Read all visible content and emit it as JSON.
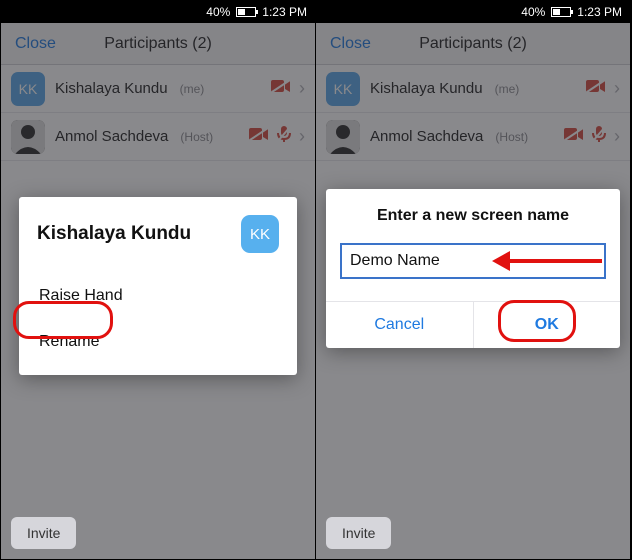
{
  "statusbar": {
    "battery_pct": "40%",
    "time": "1:23 PM"
  },
  "navbar": {
    "close_label": "Close",
    "title": "Participants (2)"
  },
  "participants": [
    {
      "initials": "KK",
      "name": "Kishalaya Kundu",
      "tag": "(me)"
    },
    {
      "name": "Anmol Sachdeva",
      "tag": "(Host)"
    }
  ],
  "footer": {
    "invite_label": "Invite"
  },
  "sheet": {
    "title": "Kishalaya Kundu",
    "initials": "KK",
    "raise_hand_label": "Raise Hand",
    "rename_label": "Rename"
  },
  "dialog": {
    "title": "Enter a new screen name",
    "input_value": "Demo Name",
    "cancel_label": "Cancel",
    "ok_label": "OK"
  }
}
